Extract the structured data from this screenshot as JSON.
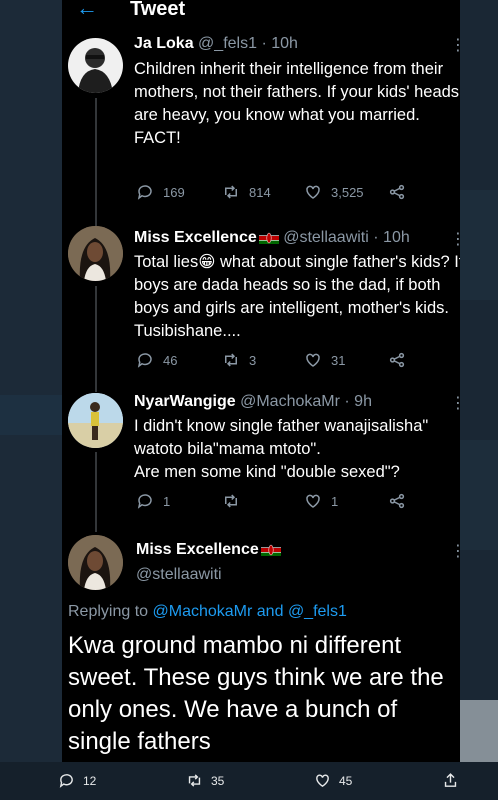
{
  "header": {
    "back_glyph": "←",
    "title": "Tweet"
  },
  "tweets": [
    {
      "name": "Ja Loka",
      "handle": "@_fels1",
      "time": "· 10h",
      "text": "Children inherit their intelligence from their mothers, not their fathers. If your kids' heads are heavy, you know what you married.\nFACT!",
      "replies": "169",
      "retweets": "814",
      "likes": "3,525"
    },
    {
      "name": "Miss Excellence",
      "handle": "@stellaawiti",
      "time": "· 10h",
      "text": "Total lies😁 what about single father's kids? If boys are dada heads so is the dad, if both boys and girls are intelligent, mother's kids. Tusibishane....",
      "replies": "46",
      "retweets": "3",
      "likes": "31"
    },
    {
      "name": "NyarWangige",
      "handle": "@MachokaMr",
      "time": "· 9h",
      "text": "I didn't know single father wanajisalisha\" watoto bila\"mama mtoto\".\nAre men some kind \"double sexed\"?",
      "replies": "1",
      "retweets": "",
      "likes": "1"
    }
  ],
  "main_tweet": {
    "name": "Miss Excellence",
    "handle": "@stellaawiti",
    "replying_prefix": "Replying to",
    "replying_user1": "@MachokaMr",
    "replying_and": "and",
    "replying_user2": "@_fels1",
    "text": "Kwa ground mambo ni different sweet. These guys think we are the only ones. We have a bunch of single fathers"
  },
  "bottom_bar": {
    "replies": "12",
    "retweets": "35",
    "likes": "45"
  },
  "colors": {
    "accent": "#1d9bf0",
    "panel": "#000000",
    "muted": "#8b98a5",
    "bg": "#15202b"
  }
}
